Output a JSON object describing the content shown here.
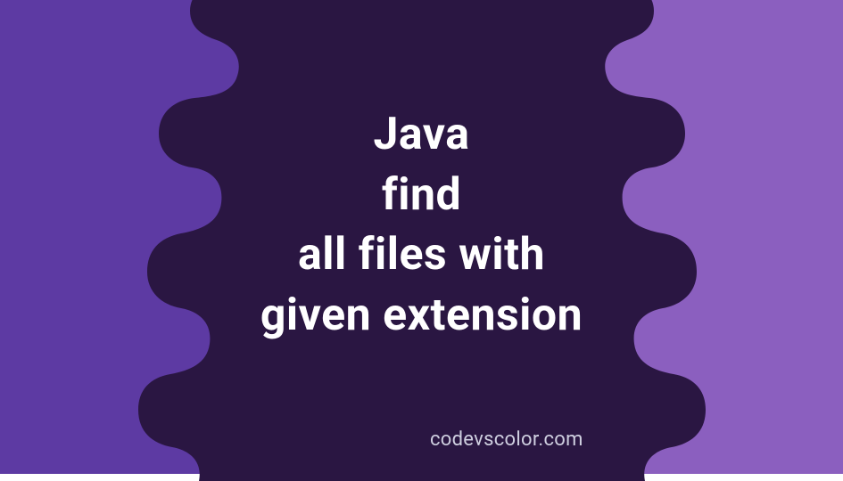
{
  "hero": {
    "title_lines": [
      "Java",
      "find",
      "all files with",
      "given extension"
    ],
    "watermark": "codevscolor.com"
  },
  "colors": {
    "bg_left": "#5d3aa3",
    "bg_right": "#8b5fbf",
    "blob": "#2a1642",
    "text": "#ffffff",
    "watermark": "#cfcfe0"
  }
}
